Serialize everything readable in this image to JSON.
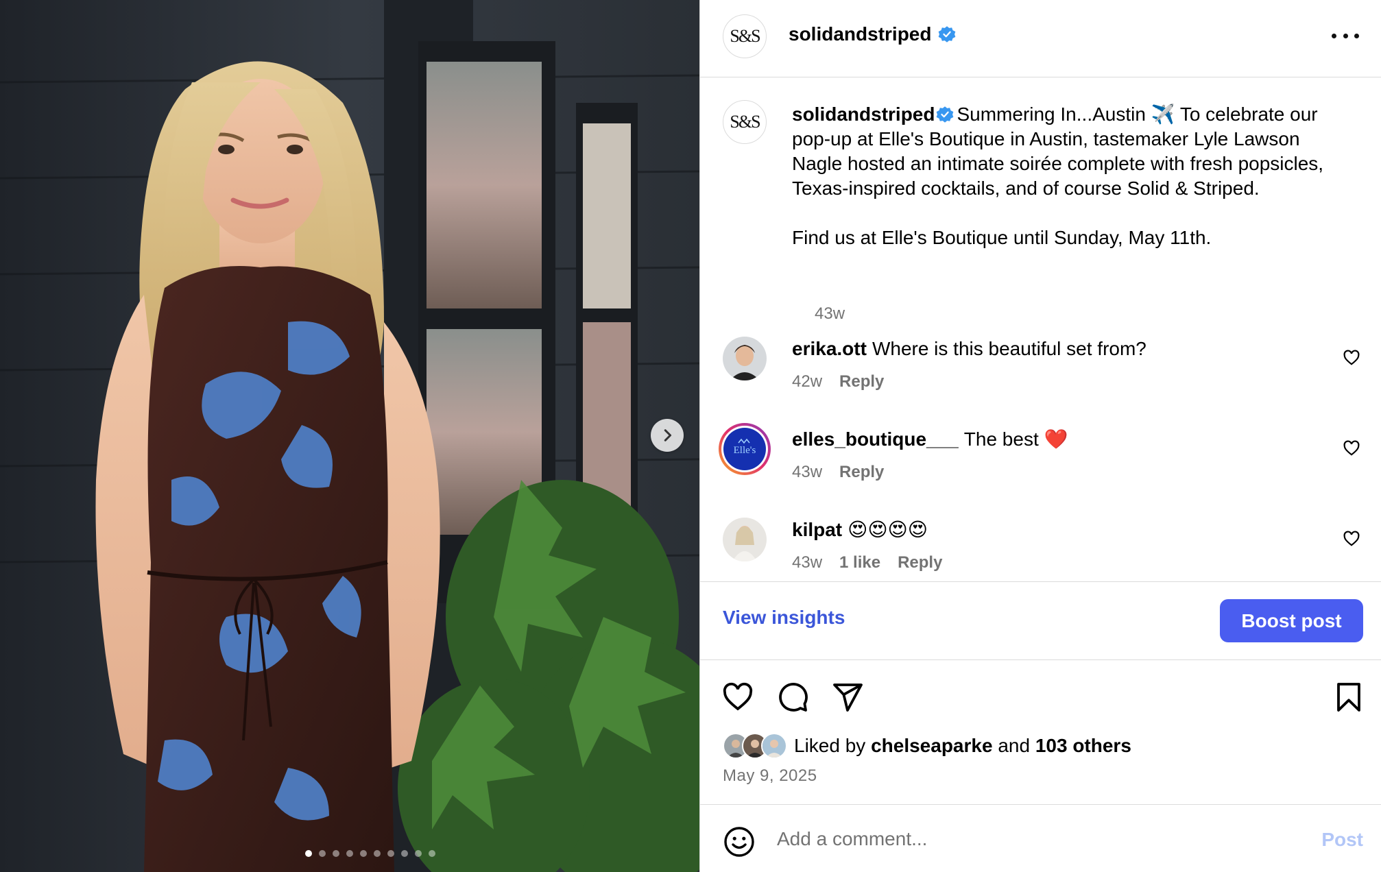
{
  "post": {
    "username": "solidandstriped",
    "avatar_text": "S&S",
    "caption_paragraph_1": "Summering In...Austin ✈️ To celebrate our pop-up at Elle's Boutique in Austin, tastemaker Lyle Lawson Nagle hosted an intimate soirée complete with fresh popsicles, Texas-inspired cocktails, and of course Solid & Striped.",
    "caption_paragraph_2": "Find us at Elle's Boutique until Sunday, May 11th.",
    "caption_time": "43w"
  },
  "carousel": {
    "slide_count": 10,
    "active_index": 0
  },
  "comments": [
    {
      "username": "erika.ott",
      "text": "Where is this beautiful set from?",
      "time": "42w",
      "likes": "",
      "reply": "Reply"
    },
    {
      "username": "elles_boutique___",
      "text": "The best ❤️",
      "time": "43w",
      "likes": "",
      "reply": "Reply",
      "avatar_text": "Elle's"
    },
    {
      "username": "kilpat",
      "text": "😍😍😍😍",
      "time": "43w",
      "likes": "1 like",
      "reply": "Reply"
    }
  ],
  "insights": {
    "view_label": "View insights",
    "boost_label": "Boost post"
  },
  "likes": {
    "prefix": "Liked by",
    "user": "chelseaparke",
    "conjunction": "and",
    "others": "103 others"
  },
  "post_date": "May 9, 2025",
  "comment_box": {
    "placeholder": "Add a comment...",
    "post_label": "Post"
  },
  "colors": {
    "link_blue": "#3b56d9",
    "boost_button": "#4a5df0",
    "verified_blue": "#3897f0",
    "muted_text": "#737373",
    "post_disabled": "#b2c6f7"
  },
  "icons": [
    "chevron-right-icon",
    "verified-badge-icon",
    "more-options-icon",
    "heart-icon",
    "comment-icon",
    "share-icon",
    "bookmark-icon",
    "emoji-icon"
  ]
}
